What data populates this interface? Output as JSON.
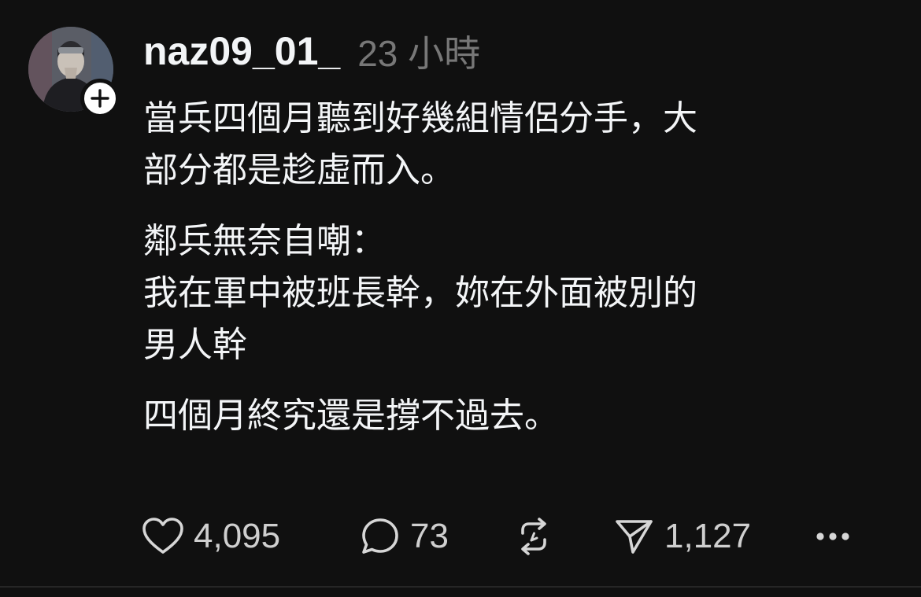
{
  "post": {
    "username": "naz09_01_",
    "timestamp": "23 小時",
    "paragraphs": [
      [
        "當兵四個月聽到好幾組情侶分手，大",
        "部分都是趁虛而入。"
      ],
      [
        "鄰兵無奈自嘲：",
        "我在軍中被班長幹，妳在外面被別的",
        "男人幹"
      ],
      [
        "四個月終究還是撐不過去。"
      ]
    ]
  },
  "actions": {
    "likes": "4,095",
    "comments": "73",
    "shares": "1,127",
    "icons": [
      "heart-icon",
      "comment-icon",
      "repost-icon",
      "share-icon",
      "more-icon"
    ]
  },
  "colors": {
    "background": "#101010",
    "text": "#f3f5f7",
    "muted": "#777777"
  }
}
